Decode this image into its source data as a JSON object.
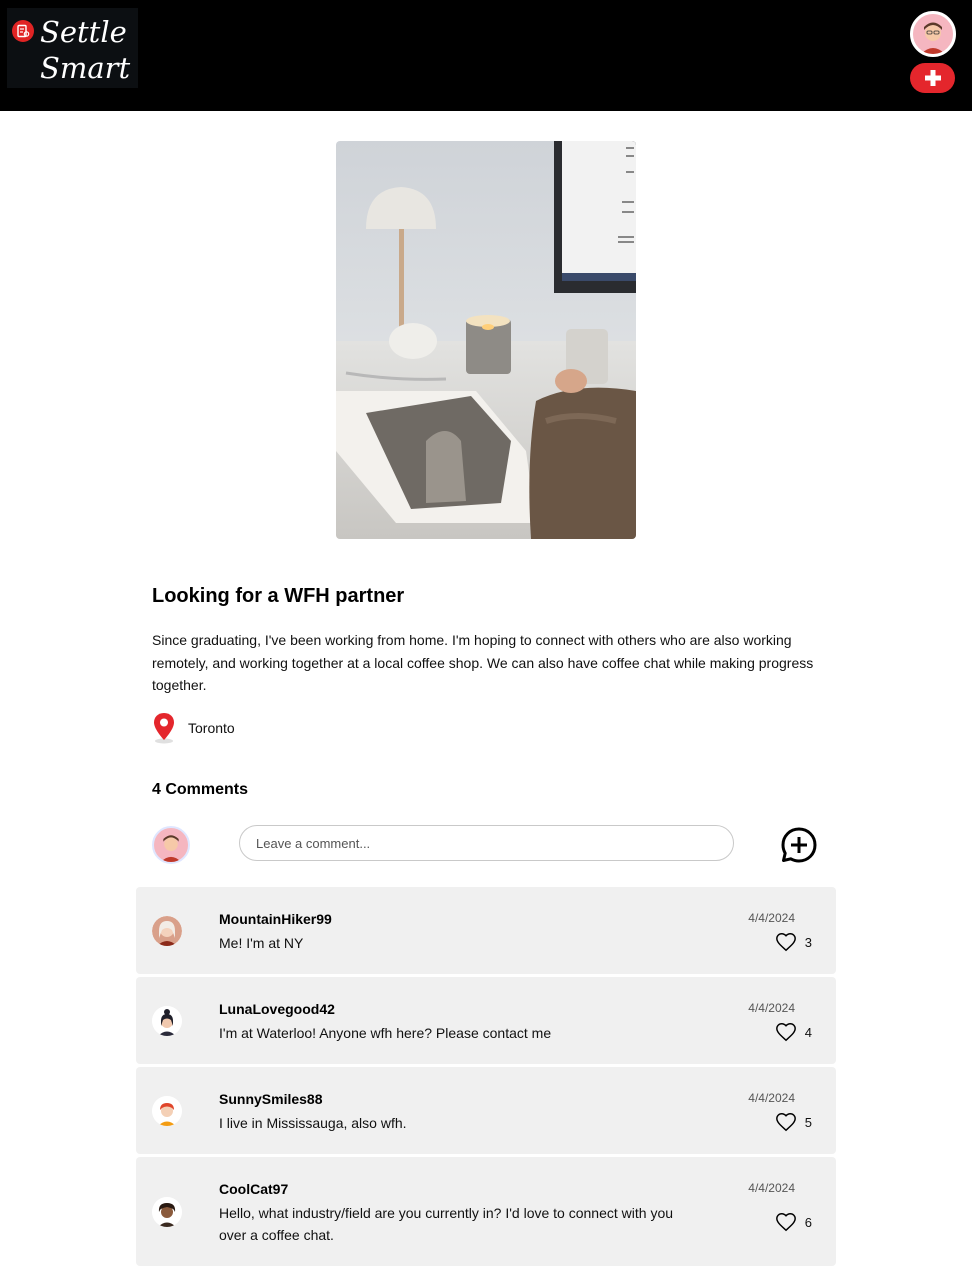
{
  "header": {
    "logo_line1": "Settle",
    "logo_line2": "Smart"
  },
  "post": {
    "title": "Looking for a WFH partner",
    "body": "Since graduating, I've been working from home. I'm hoping to connect with others who are also working remotely, and working together at a local coffee shop. We can also have coffee chat while making progress together.",
    "location": "Toronto"
  },
  "comments_section": {
    "heading": "4 Comments",
    "input_placeholder": "Leave a comment..."
  },
  "comments": [
    {
      "user": "MountainHiker99",
      "text": "Me! I'm at NY",
      "date": "4/4/2024",
      "likes": "3",
      "avatar_icon": "woman-white-hair-avatar"
    },
    {
      "user": "LunaLovegood42",
      "text": "I'm at Waterloo! Anyone wfh here? Please contact me",
      "date": "4/4/2024",
      "likes": "4",
      "avatar_icon": "woman-dark-bun-avatar"
    },
    {
      "user": "SunnySmiles88",
      "text": "I live in Mississauga, also wfh.",
      "date": "4/4/2024",
      "likes": "5",
      "avatar_icon": "redhead-avatar"
    },
    {
      "user": "CoolCat97",
      "text": "Hello, what industry/field are you currently in? I'd love to connect with you over a coffee chat.",
      "date": "4/4/2024",
      "likes": "6",
      "avatar_icon": "curly-hair-avatar"
    }
  ],
  "colors": {
    "header_bg": "#000000",
    "accent_red": "#e4262c",
    "card_bg": "#f0f0f0"
  }
}
